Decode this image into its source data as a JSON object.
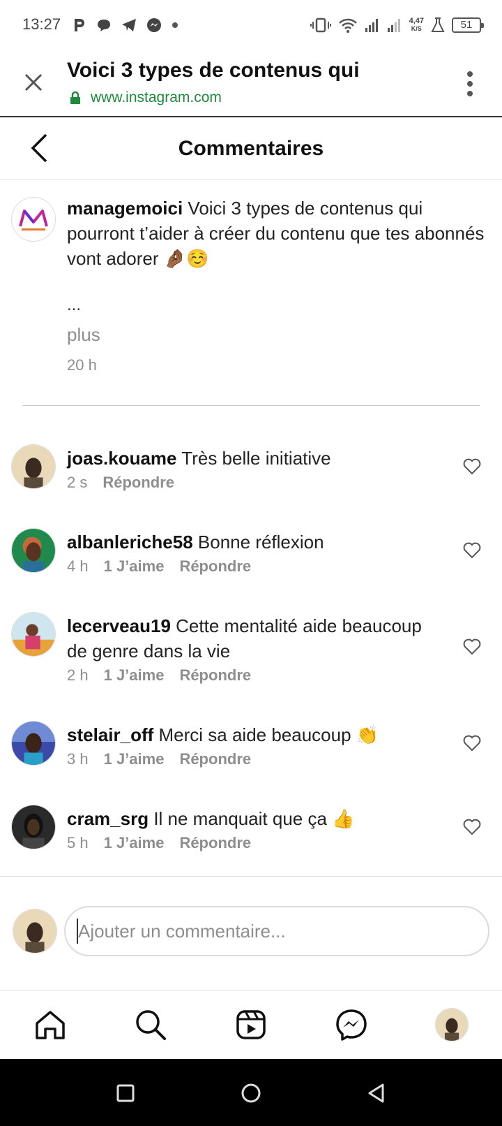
{
  "status_bar": {
    "time": "13:27",
    "speed_value": "4,47",
    "speed_unit": "K/S",
    "battery": "51"
  },
  "browser": {
    "title": "Voici 3 types de contenus qui",
    "url": "www.instagram.com"
  },
  "page": {
    "title": "Commentaires"
  },
  "caption": {
    "username": "managemoici",
    "text": "Voici 3 types de contenus qui pourront t’aider à créer du contenu que tes abonnés vont adorer 🤌🏾☺️",
    "ellipsis": "...",
    "more": "plus",
    "time": "20 h"
  },
  "comments": [
    {
      "username": "joas.kouame",
      "text": "Très belle initiative",
      "time": "2 s",
      "likes": "",
      "reply": "Répondre"
    },
    {
      "username": "albanleriche58",
      "text": "Bonne réflexion",
      "time": "4 h",
      "likes": "1 J’aime",
      "reply": "Répondre"
    },
    {
      "username": "lecerveau19",
      "text": "Cette mentalité aide beaucoup de genre dans la vie",
      "time": "2 h",
      "likes": "1 J’aime",
      "reply": "Répondre"
    },
    {
      "username": "stelair_off",
      "text": "Merci sa aide beaucoup 👏",
      "time": "3 h",
      "likes": "1 J’aime",
      "reply": "Répondre"
    },
    {
      "username": "cram_srg",
      "text": "Il ne manquait que ça 👍",
      "time": "5 h",
      "likes": "1 J’aime",
      "reply": "Répondre"
    }
  ],
  "input": {
    "placeholder": "Ajouter un commentaire..."
  },
  "colors": {
    "url_green": "#1d8a3c",
    "muted_text": "#8e8e8e",
    "brand_m": "#c0249c"
  },
  "icons": {
    "nav": [
      "home-icon",
      "search-icon",
      "reels-icon",
      "messenger-icon",
      "profile-avatar"
    ],
    "system": [
      "recents-icon",
      "home-circle-icon",
      "back-triangle-icon"
    ]
  }
}
